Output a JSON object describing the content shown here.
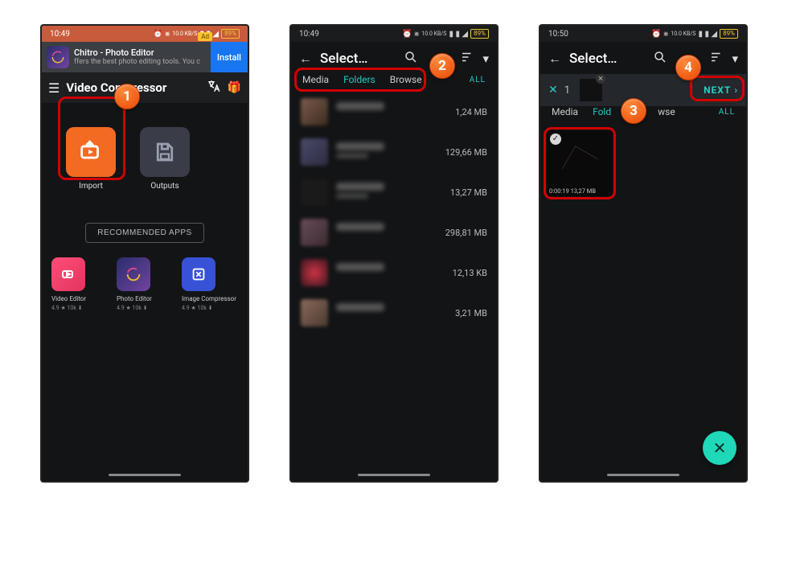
{
  "statusbar": {
    "time1": "10:49",
    "time2": "10:49",
    "time3": "10:50",
    "battery": "89%",
    "net": "10.0 KB/S",
    "icons": "⏰ ⨳"
  },
  "phone1": {
    "ad": {
      "tag": "Ad",
      "title": "Chitro - Photo Editor",
      "subtitle": "ffers the best photo editing tools. You c",
      "install": "Install"
    },
    "header": {
      "title": "Video Compressor"
    },
    "tiles": {
      "import": "Import",
      "outputs": "Outputs"
    },
    "recommended": {
      "button": "RECOMMENDED APPS",
      "items": [
        {
          "name": "Video Editor",
          "meta": "4.9 ★  10k ⬇"
        },
        {
          "name": "Photo Editor",
          "meta": "4.9 ★  10k ⬇"
        },
        {
          "name": "Image Compressor",
          "meta": "4.9 ★  10k ⬇"
        }
      ]
    }
  },
  "phone2": {
    "toolbar_title": "Select…",
    "tabs": {
      "media": "Media",
      "folders": "Folders",
      "browse": "Browse",
      "all": "ALL"
    },
    "rows": [
      {
        "size": "1,24 MB"
      },
      {
        "size": "129,66 MB"
      },
      {
        "size": "13,27 MB"
      },
      {
        "size": "298,81 MB"
      },
      {
        "size": "12,13 KB"
      },
      {
        "size": "3,21 MB"
      }
    ]
  },
  "phone3": {
    "toolbar_title": "Select…",
    "selection": {
      "count": "1",
      "next": "NEXT"
    },
    "tabs": {
      "media": "Media",
      "folders": "Fold",
      "browse": "wse",
      "all": "ALL"
    },
    "video": {
      "duration": "0:00:19",
      "size": "13,27 MB"
    }
  },
  "callouts": {
    "b1": "1",
    "b2": "2",
    "b3": "3",
    "b4": "4"
  }
}
